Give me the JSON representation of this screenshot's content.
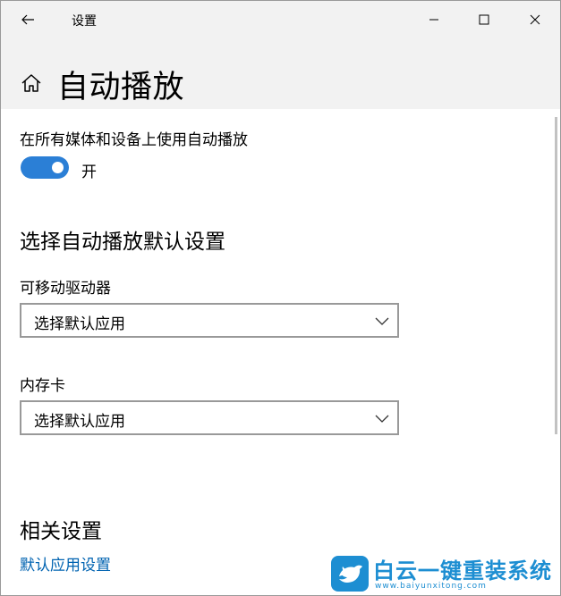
{
  "window": {
    "title": "设置"
  },
  "page": {
    "title": "自动播放"
  },
  "autoplay": {
    "label": "在所有媒体和设备上使用自动播放",
    "toggle_state": "开"
  },
  "defaults": {
    "section_title": "选择自动播放默认设置",
    "removable_drive": {
      "label": "可移动驱动器",
      "value": "选择默认应用"
    },
    "memory_card": {
      "label": "内存卡",
      "value": "选择默认应用"
    }
  },
  "related": {
    "section_title": "相关设置",
    "link": "默认应用设置"
  },
  "watermark": {
    "title": "白云一键重装系统",
    "url": "www.baiyunxitong.com"
  },
  "colors": {
    "accent": "#2b7fd6",
    "link": "#0063b1",
    "header_bg": "#f2f2f2",
    "watermark": "#1d8ed2"
  },
  "icons": [
    "back-arrow-icon",
    "minimize-icon",
    "maximize-icon",
    "close-icon",
    "home-icon",
    "chevron-down-icon",
    "bird-logo-icon"
  ]
}
